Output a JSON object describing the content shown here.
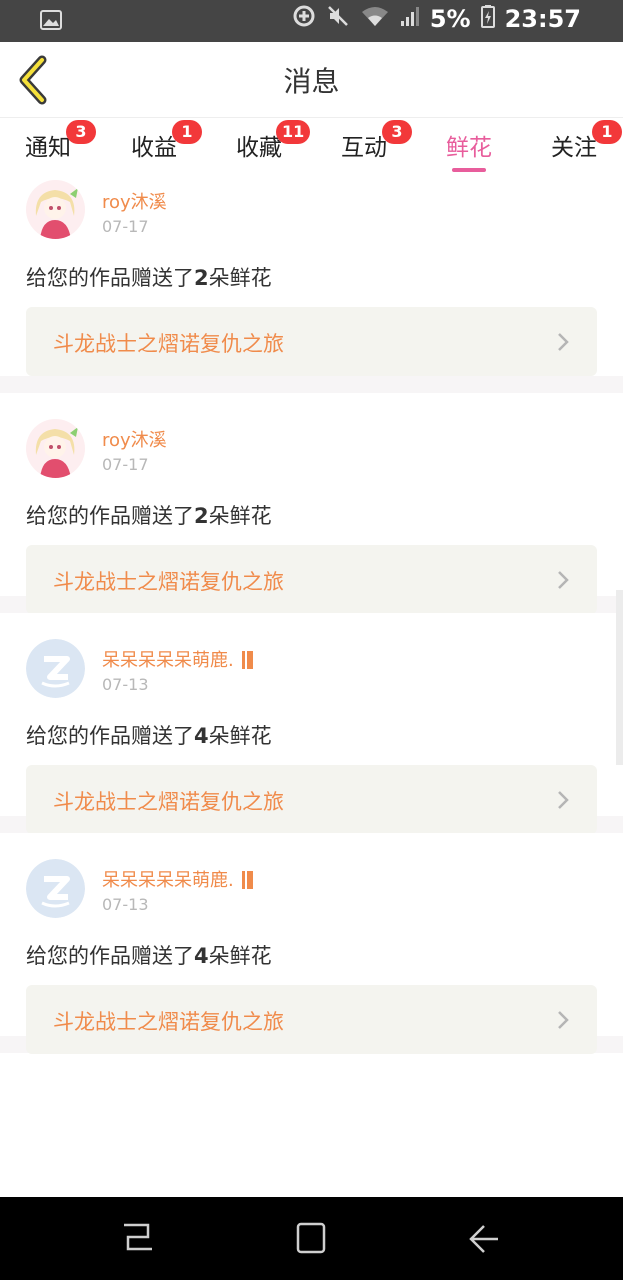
{
  "status_bar": {
    "battery": "5%",
    "time": "23:57",
    "icons": [
      "image-icon",
      "data-saver-icon",
      "mute-icon",
      "wifi-icon",
      "signal-icon",
      "battery-icon"
    ]
  },
  "header": {
    "title": "消息",
    "back_icon": "chevron-left-icon"
  },
  "tabs": [
    {
      "label": "通知",
      "badge": "3",
      "active": false
    },
    {
      "label": "收益",
      "badge": "1",
      "active": false
    },
    {
      "label": "收藏",
      "badge": "11",
      "active": false
    },
    {
      "label": "互动",
      "badge": "3",
      "active": false
    },
    {
      "label": "鲜花",
      "badge": "",
      "active": true
    },
    {
      "label": "关注",
      "badge": "1",
      "active": false
    }
  ],
  "messages": [
    {
      "user": "roy沐溪",
      "date": "07-17",
      "text_prefix": "给您的作品赠送了",
      "count": "2",
      "text_suffix": "朵鲜花",
      "work": "斗龙战士之熠诺复仇之旅",
      "avatar": "anime-girl"
    },
    {
      "user": "roy沐溪",
      "date": "07-17",
      "text_prefix": "给您的作品赠送了",
      "count": "2",
      "text_suffix": "朵鲜花",
      "work": "斗龙战士之熠诺复仇之旅",
      "avatar": "anime-girl"
    },
    {
      "user": "呆呆呆呆呆萌鹿.",
      "date": "07-13",
      "text_prefix": "给您的作品赠送了",
      "count": "4",
      "text_suffix": "朵鲜花",
      "work": "斗龙战士之熠诺复仇之旅",
      "avatar": "default-qq"
    },
    {
      "user": "呆呆呆呆呆萌鹿.",
      "date": "07-13",
      "text_prefix": "给您的作品赠送了",
      "count": "4",
      "text_suffix": "朵鲜花",
      "work": "斗龙战士之熠诺复仇之旅",
      "avatar": "default-qq"
    }
  ],
  "colors": {
    "accent": "#e85d9c",
    "orange": "#f08b4b",
    "badge": "#f2383a"
  }
}
